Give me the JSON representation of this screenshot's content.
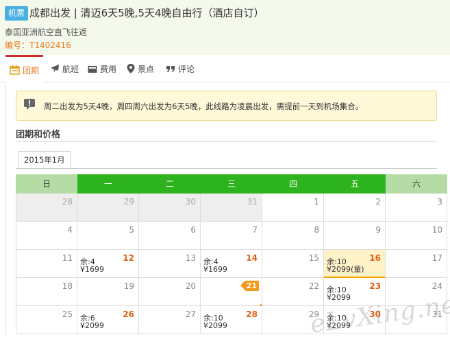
{
  "header": {
    "tag": "机票",
    "title": "成都出发 | 清迈6天5晚,5天4晚自由行（酒店自订）",
    "subtitle": "泰国亚洲航空直飞往返",
    "code": "编号：T1402416"
  },
  "tabs": [
    {
      "label": "团期",
      "icon": "calendar-icon"
    },
    {
      "label": "航班",
      "icon": "plane-icon"
    },
    {
      "label": "费用",
      "icon": "wallet-icon"
    },
    {
      "label": "景点",
      "icon": "location-pin-icon"
    },
    {
      "label": "评论",
      "icon": "quote-icon"
    }
  ],
  "notice": "周二出发为5天4晚，周四周六出发为6天5晚，此线路为凌晨出发，需提前一天到机场集合。",
  "section_title": "团期和价格",
  "month_tab": "2015年1月",
  "weekdays": [
    "日",
    "一",
    "二",
    "三",
    "四",
    "五",
    "六"
  ],
  "calendar": {
    "rows": [
      [
        {
          "day": "28",
          "prev": true
        },
        {
          "day": "29",
          "prev": true
        },
        {
          "day": "30",
          "prev": true
        },
        {
          "day": "31",
          "prev": true
        },
        {
          "day": "1"
        },
        {
          "day": "2"
        },
        {
          "day": "3"
        }
      ],
      [
        {
          "day": "4"
        },
        {
          "day": "5"
        },
        {
          "day": "6"
        },
        {
          "day": "7"
        },
        {
          "day": "8"
        },
        {
          "day": "9"
        },
        {
          "day": "10"
        }
      ],
      [
        {
          "day": "11"
        },
        {
          "day": "12",
          "hot": true,
          "avail": "余:4",
          "price": "¥1699"
        },
        {
          "day": "13"
        },
        {
          "day": "14",
          "hot": true,
          "avail": "余:4",
          "price": "¥1699"
        },
        {
          "day": "15"
        },
        {
          "day": "16",
          "hot": true,
          "avail": "余:10",
          "price": "¥2099(童)",
          "selected": true
        },
        {
          "day": "17"
        }
      ],
      [
        {
          "day": "18"
        },
        {
          "day": "19"
        },
        {
          "day": "20"
        },
        {
          "day": "21",
          "today": true
        },
        {
          "day": "22"
        },
        {
          "day": "23",
          "hot": true,
          "avail": "余:10",
          "price": "¥2099"
        },
        {
          "day": "24"
        }
      ],
      [
        {
          "day": "25"
        },
        {
          "day": "26",
          "hot": true,
          "avail": "余:6",
          "price": "¥2099"
        },
        {
          "day": "27"
        },
        {
          "day": "28",
          "hot": true,
          "avail": "余:10",
          "price": "¥2099"
        },
        {
          "day": "29"
        },
        {
          "day": "30",
          "hot": true,
          "avail": "余:10",
          "price": "¥2099"
        },
        {
          "day": "31"
        }
      ]
    ]
  },
  "watermark": "eLvXing.net",
  "colors": {
    "accent": "#e67a1e",
    "weekday_header": "#2db31e",
    "weekend_header": "#b6dca6",
    "tag": "#4ab0e3",
    "notice_bg": "#fff8d9"
  }
}
